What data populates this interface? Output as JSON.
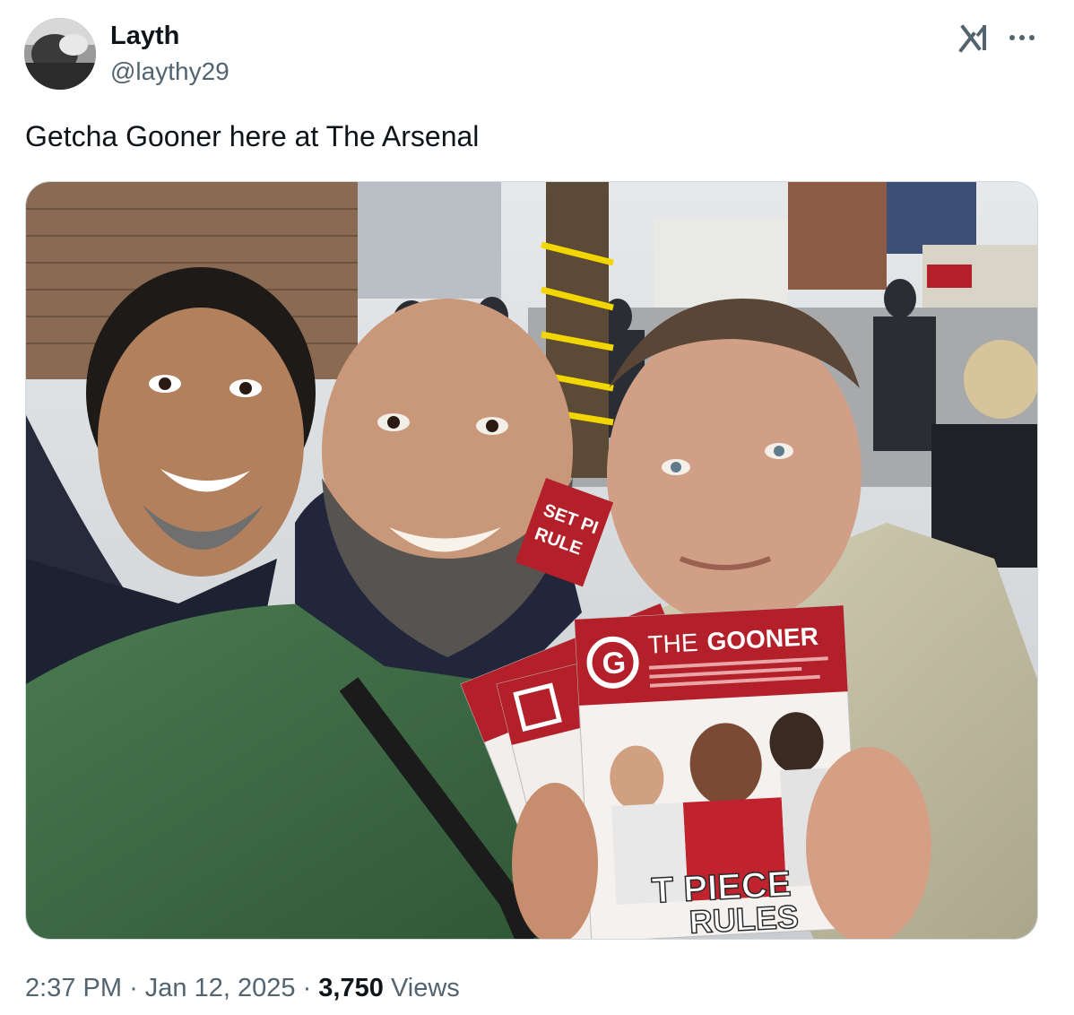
{
  "author": {
    "display_name": "Layth",
    "handle": "@laythy29",
    "avatar_icon": "profile-avatar"
  },
  "header_icons": {
    "grok": "grok-icon",
    "more": "more-icon"
  },
  "tweet": {
    "text": "Getcha Gooner here at The Arsenal"
  },
  "photo": {
    "magazine": {
      "brand_the": "THE",
      "brand_gooner": "GOONER",
      "logo_letter": "G",
      "cover_headline_line1": "T PIECE",
      "cover_headline_line2": "RULES",
      "back_copy_fragment": "SET PI",
      "back_copy_fragment_2": "RULE"
    }
  },
  "meta": {
    "time": "2:37 PM",
    "separator": "·",
    "date": "Jan 12, 2025",
    "views_count": "3,750",
    "views_label": "Views"
  },
  "colors": {
    "text_primary": "#0f1419",
    "text_secondary": "#536471",
    "magazine_red": "#b3202a",
    "jacket_green": "#3f6b45",
    "jacket_beige": "#c9c4a8"
  }
}
